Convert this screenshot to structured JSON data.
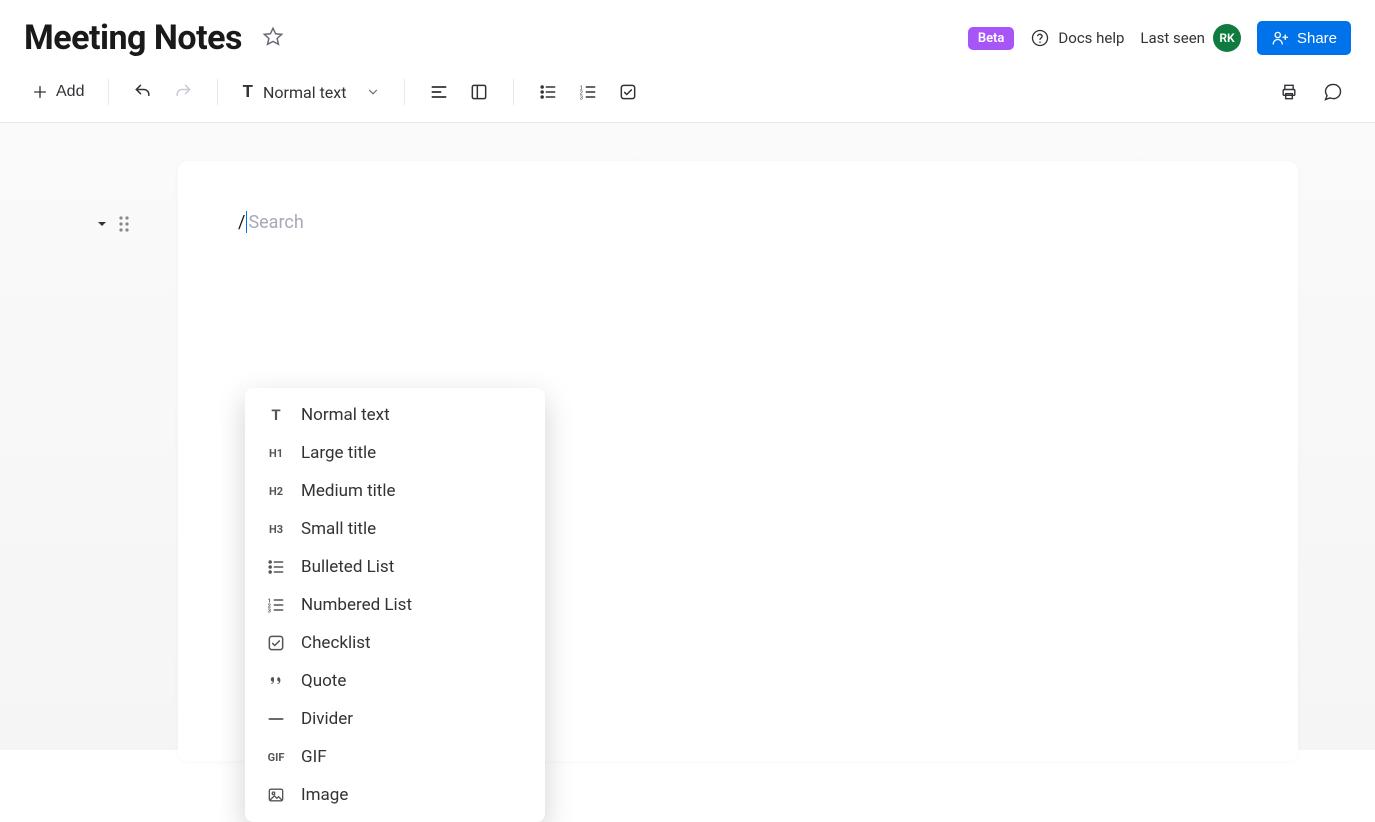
{
  "document": {
    "title": "Meeting Notes"
  },
  "header": {
    "beta_label": "Beta",
    "help_label": "Docs help",
    "last_seen_label": "Last seen",
    "avatar_initials": "RK",
    "share_label": "Share"
  },
  "toolbar": {
    "add_label": "Add",
    "style_label": "Normal text"
  },
  "editor": {
    "slash_char": "/",
    "search_placeholder": "Search"
  },
  "slash_menu": {
    "items": [
      {
        "icon": "T",
        "icon_type": "text",
        "label": "Normal text",
        "name": "menu-normal-text"
      },
      {
        "icon": "H1",
        "icon_type": "text",
        "label": "Large title",
        "name": "menu-large-title"
      },
      {
        "icon": "H2",
        "icon_type": "text",
        "label": "Medium title",
        "name": "menu-medium-title"
      },
      {
        "icon": "H3",
        "icon_type": "text",
        "label": "Small title",
        "name": "menu-small-title"
      },
      {
        "icon": "bulleted",
        "icon_type": "svg",
        "label": "Bulleted List",
        "name": "menu-bulleted-list"
      },
      {
        "icon": "numbered",
        "icon_type": "svg",
        "label": "Numbered List",
        "name": "menu-numbered-list"
      },
      {
        "icon": "checklist",
        "icon_type": "svg",
        "label": "Checklist",
        "name": "menu-checklist"
      },
      {
        "icon": "quote",
        "icon_type": "svg",
        "label": "Quote",
        "name": "menu-quote"
      },
      {
        "icon": "divider",
        "icon_type": "svg",
        "label": "Divider",
        "name": "menu-divider"
      },
      {
        "icon": "GIF",
        "icon_type": "text",
        "label": "GIF",
        "name": "menu-gif"
      },
      {
        "icon": "image",
        "icon_type": "svg",
        "label": "Image",
        "name": "menu-image"
      }
    ]
  }
}
